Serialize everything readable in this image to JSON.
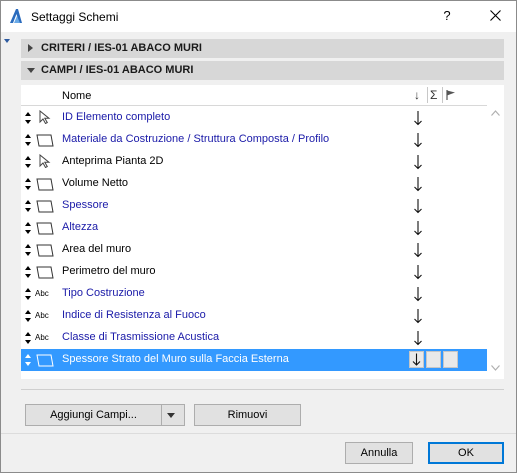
{
  "window": {
    "title": "Settaggi Schemi",
    "help_glyph": "?",
    "accent_color": "#0078d7",
    "selection_color": "#3399ff",
    "blue_text_color": "#1a1aa8"
  },
  "sections": {
    "criteri": {
      "label": "CRITERI / IES-01 ABACO MURI",
      "state": "collapsed"
    },
    "campi": {
      "label": "CAMPI / IES-01 ABACO MURI",
      "state": "expanded"
    }
  },
  "list": {
    "header": {
      "name_label": "Nome",
      "sort_glyph": "↓",
      "sum_glyph": "Σ",
      "flag_icon": "flag-icon"
    },
    "rows": [
      {
        "label": "ID Elemento completo",
        "icon": "arrow-cursor-icon",
        "blue": true
      },
      {
        "label": "Materiale da Costruzione / Struttura Composta / Profilo",
        "icon": "wall-shape-icon",
        "blue": true
      },
      {
        "label": "Anteprima Pianta 2D",
        "icon": "arrow-cursor-icon",
        "blue": false
      },
      {
        "label": "Volume Netto",
        "icon": "wall-shape-icon",
        "blue": false
      },
      {
        "label": "Spessore",
        "icon": "wall-shape-icon",
        "blue": true
      },
      {
        "label": "Altezza",
        "icon": "wall-shape-icon",
        "blue": true
      },
      {
        "label": "Area del muro",
        "icon": "wall-shape-icon",
        "blue": false
      },
      {
        "label": "Perimetro del muro",
        "icon": "wall-shape-icon",
        "blue": false
      },
      {
        "label": "Tipo Costruzione",
        "icon": "abc-icon",
        "icon_text": "Abc",
        "blue": true
      },
      {
        "label": "Indice di Resistenza al Fuoco",
        "icon": "abc-icon",
        "icon_text": "Abc",
        "blue": true
      },
      {
        "label": "Classe di Trasmissione Acustica",
        "icon": "abc-icon",
        "icon_text": "Abc",
        "blue": true
      },
      {
        "label": "Spessore Strato del Muro sulla Faccia Esterna",
        "icon": "wall-shape-icon",
        "blue": false,
        "selected": true
      }
    ]
  },
  "buttons": {
    "add_fields": "Aggiungi Campi...",
    "remove": "Rimuovi",
    "cancel": "Annulla",
    "ok": "OK"
  }
}
